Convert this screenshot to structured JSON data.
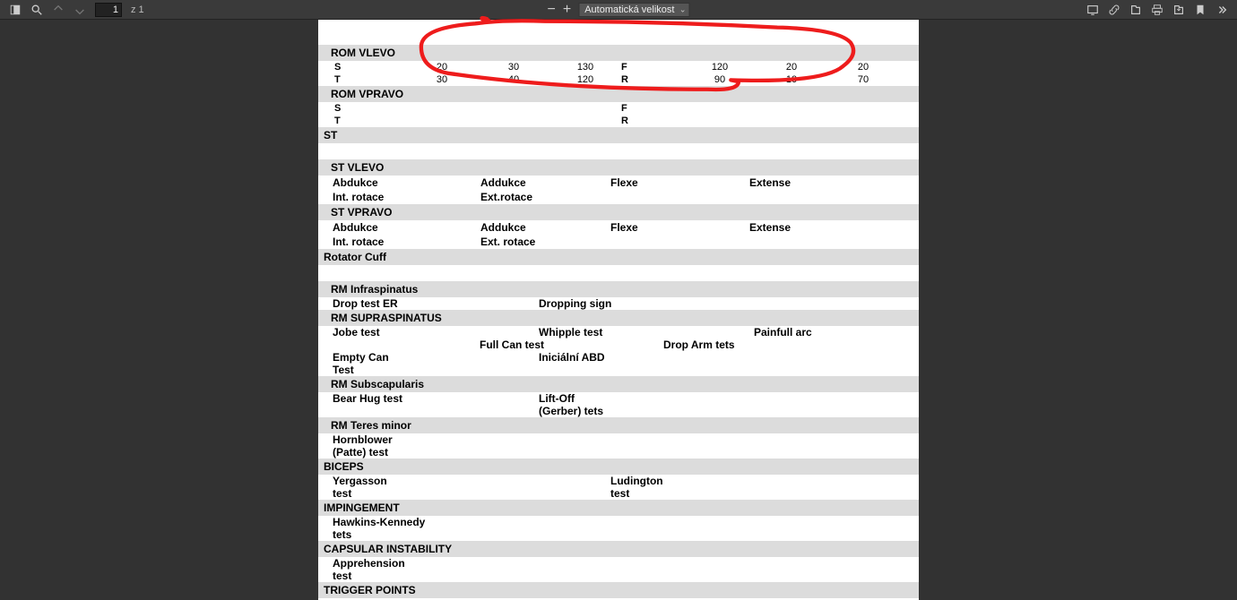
{
  "toolbar": {
    "page_input": "1",
    "page_total": "z 1",
    "zoom_label": "Automatická velikost"
  },
  "sections": {
    "rom_vlevo": "ROM VLEVO",
    "rom_vpravo": "ROM VPRAVO",
    "st": "ST",
    "st_vlevo": "ST VLEVO",
    "st_vpravo": "ST VPRAVO",
    "rotator_cuff": "Rotator Cuff",
    "rm_infra": "RM Infraspinatus",
    "rm_supra": "RM SUPRASPINATUS",
    "rm_subsc": "RM Subscapularis",
    "rm_teres": "RM Teres minor",
    "biceps": "BICEPS",
    "imping": "IMPINGEMENT",
    "capsular": "CAPSULAR INSTABILITY",
    "trigger": "TRIGGER POINTS"
  },
  "rom_vlevo_data": {
    "S": {
      "label": "S",
      "a": "20",
      "b": "30",
      "c": "130"
    },
    "T": {
      "label": "T",
      "a": "30",
      "b": "40",
      "c": "120"
    },
    "F": {
      "label": "F",
      "a": "120",
      "b": "20",
      "c": "20"
    },
    "R": {
      "label": "R",
      "a": "90",
      "b": "10",
      "c": "70"
    }
  },
  "rom_vpravo_data": {
    "S": {
      "label": "S"
    },
    "T": {
      "label": "T"
    },
    "F": {
      "label": "F"
    },
    "R": {
      "label": "R"
    }
  },
  "st_vlevo": {
    "r1": {
      "a": "Abdukce",
      "b": "Addukce",
      "c": "Flexe",
      "d": "Extense"
    },
    "r2": {
      "a": "Int. rotace",
      "b": "Ext.rotace"
    }
  },
  "st_vpravo": {
    "r1": {
      "a": "Abdukce",
      "b": "Addukce",
      "c": "Flexe",
      "d": "Extense"
    },
    "r2": {
      "a": "Int. rotace",
      "b": "Ext. rotace"
    }
  },
  "rm_infra": {
    "a": "Drop test ER",
    "b": "Dropping sign"
  },
  "rm_supra": {
    "r1": {
      "a": "Jobe test",
      "b": "Whipple test",
      "c": "Painfull arc"
    },
    "r2": {
      "a": "Full Can test",
      "b": "Drop Arm tets"
    },
    "r3": {
      "a": "Empty Can Test",
      "b": "Iniciální ABD"
    }
  },
  "rm_subsc": {
    "a": "Bear Hug test",
    "b": "Lift-Off (Gerber) tets"
  },
  "rm_teres": {
    "a": "Hornblower (Patte) test"
  },
  "biceps": {
    "a": "Yergasson test",
    "b": "Ludington test"
  },
  "imping": {
    "a": "Hawkins-Kennedy tets"
  },
  "capsular": {
    "a": "Apprehension test"
  }
}
